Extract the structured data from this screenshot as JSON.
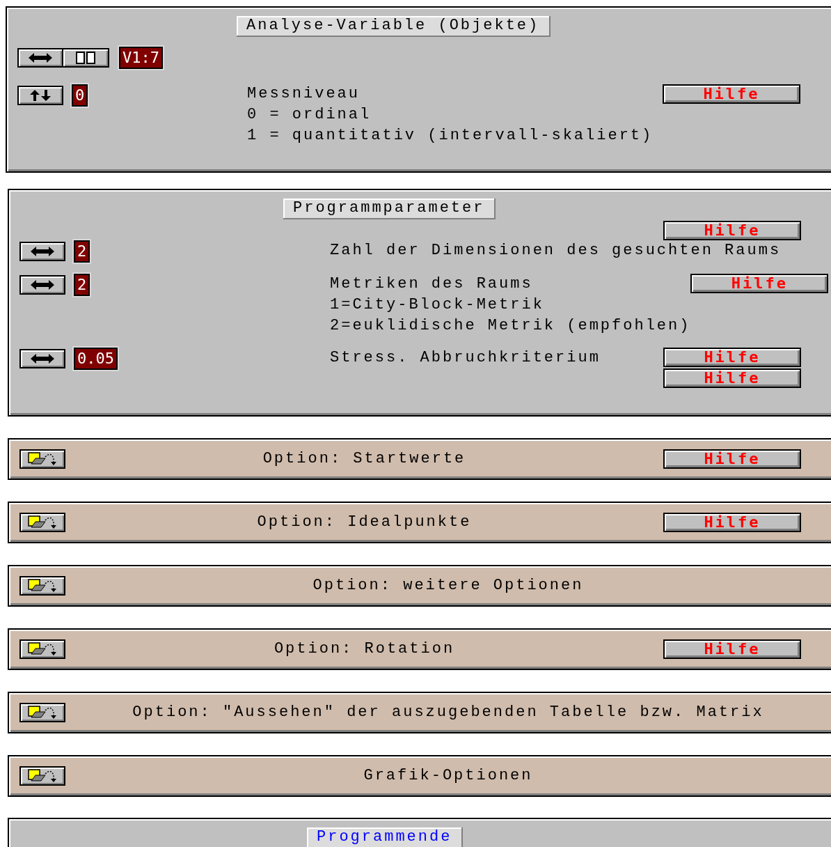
{
  "variable_panel": {
    "title": "Analyse-Variable (Objekte)",
    "variable": "V1:7",
    "level_value": "0",
    "description": [
      "Messniveau",
      "0 = ordinal",
      "1 = quantitativ (intervall-skaliert)"
    ],
    "help": "Hilfe"
  },
  "parameters_panel": {
    "title": "Programmparameter",
    "rows": [
      {
        "value": "2",
        "description": [
          "Zahl der Dimensionen des gesuchten Raums"
        ],
        "help": [
          "Hilfe"
        ]
      },
      {
        "value": "2",
        "description": [
          "Metriken des Raums",
          "1=City-Block-Metrik",
          "2=euklidische Metrik (empfohlen)"
        ],
        "help": [
          "Hilfe"
        ]
      },
      {
        "value": "0.05",
        "description": [
          "Stress. Abbruchkriterium"
        ],
        "help": [
          "Hilfe",
          "Hilfe"
        ]
      }
    ]
  },
  "options": [
    {
      "label": "Option: Startwerte",
      "help": "Hilfe"
    },
    {
      "label": "Option: Idealpunkte",
      "help": "Hilfe"
    },
    {
      "label": "Option: weitere Optionen"
    },
    {
      "label": "Option: Rotation",
      "help": "Hilfe"
    },
    {
      "label": "Option: \"Aussehen\" der auszugebenden Tabelle bzw. Matrix"
    },
    {
      "label": "Grafik-Optionen"
    }
  ],
  "end_button": "Programmende"
}
